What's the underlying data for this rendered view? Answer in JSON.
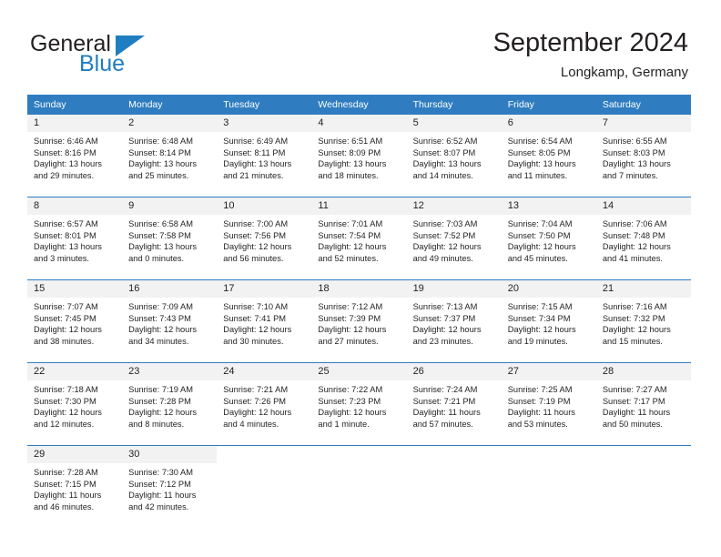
{
  "brand": {
    "name_part1": "General",
    "name_part2": "Blue",
    "flag_icon": "blue-triangle-flag-icon"
  },
  "header": {
    "title": "September 2024",
    "location": "Longkamp, Germany"
  },
  "colors": {
    "header_blue": "#2f7dc0",
    "brand_blue": "#1f7ec2",
    "daynum_bg": "#f2f2f2",
    "text": "#231f20"
  },
  "weekdays": [
    "Sunday",
    "Monday",
    "Tuesday",
    "Wednesday",
    "Thursday",
    "Friday",
    "Saturday"
  ],
  "weeks": [
    [
      {
        "day": "1",
        "sunrise": "Sunrise: 6:46 AM",
        "sunset": "Sunset: 8:16 PM",
        "daylight1": "Daylight: 13 hours",
        "daylight2": "and 29 minutes."
      },
      {
        "day": "2",
        "sunrise": "Sunrise: 6:48 AM",
        "sunset": "Sunset: 8:14 PM",
        "daylight1": "Daylight: 13 hours",
        "daylight2": "and 25 minutes."
      },
      {
        "day": "3",
        "sunrise": "Sunrise: 6:49 AM",
        "sunset": "Sunset: 8:11 PM",
        "daylight1": "Daylight: 13 hours",
        "daylight2": "and 21 minutes."
      },
      {
        "day": "4",
        "sunrise": "Sunrise: 6:51 AM",
        "sunset": "Sunset: 8:09 PM",
        "daylight1": "Daylight: 13 hours",
        "daylight2": "and 18 minutes."
      },
      {
        "day": "5",
        "sunrise": "Sunrise: 6:52 AM",
        "sunset": "Sunset: 8:07 PM",
        "daylight1": "Daylight: 13 hours",
        "daylight2": "and 14 minutes."
      },
      {
        "day": "6",
        "sunrise": "Sunrise: 6:54 AM",
        "sunset": "Sunset: 8:05 PM",
        "daylight1": "Daylight: 13 hours",
        "daylight2": "and 11 minutes."
      },
      {
        "day": "7",
        "sunrise": "Sunrise: 6:55 AM",
        "sunset": "Sunset: 8:03 PM",
        "daylight1": "Daylight: 13 hours",
        "daylight2": "and 7 minutes."
      }
    ],
    [
      {
        "day": "8",
        "sunrise": "Sunrise: 6:57 AM",
        "sunset": "Sunset: 8:01 PM",
        "daylight1": "Daylight: 13 hours",
        "daylight2": "and 3 minutes."
      },
      {
        "day": "9",
        "sunrise": "Sunrise: 6:58 AM",
        "sunset": "Sunset: 7:58 PM",
        "daylight1": "Daylight: 13 hours",
        "daylight2": "and 0 minutes."
      },
      {
        "day": "10",
        "sunrise": "Sunrise: 7:00 AM",
        "sunset": "Sunset: 7:56 PM",
        "daylight1": "Daylight: 12 hours",
        "daylight2": "and 56 minutes."
      },
      {
        "day": "11",
        "sunrise": "Sunrise: 7:01 AM",
        "sunset": "Sunset: 7:54 PM",
        "daylight1": "Daylight: 12 hours",
        "daylight2": "and 52 minutes."
      },
      {
        "day": "12",
        "sunrise": "Sunrise: 7:03 AM",
        "sunset": "Sunset: 7:52 PM",
        "daylight1": "Daylight: 12 hours",
        "daylight2": "and 49 minutes."
      },
      {
        "day": "13",
        "sunrise": "Sunrise: 7:04 AM",
        "sunset": "Sunset: 7:50 PM",
        "daylight1": "Daylight: 12 hours",
        "daylight2": "and 45 minutes."
      },
      {
        "day": "14",
        "sunrise": "Sunrise: 7:06 AM",
        "sunset": "Sunset: 7:48 PM",
        "daylight1": "Daylight: 12 hours",
        "daylight2": "and 41 minutes."
      }
    ],
    [
      {
        "day": "15",
        "sunrise": "Sunrise: 7:07 AM",
        "sunset": "Sunset: 7:45 PM",
        "daylight1": "Daylight: 12 hours",
        "daylight2": "and 38 minutes."
      },
      {
        "day": "16",
        "sunrise": "Sunrise: 7:09 AM",
        "sunset": "Sunset: 7:43 PM",
        "daylight1": "Daylight: 12 hours",
        "daylight2": "and 34 minutes."
      },
      {
        "day": "17",
        "sunrise": "Sunrise: 7:10 AM",
        "sunset": "Sunset: 7:41 PM",
        "daylight1": "Daylight: 12 hours",
        "daylight2": "and 30 minutes."
      },
      {
        "day": "18",
        "sunrise": "Sunrise: 7:12 AM",
        "sunset": "Sunset: 7:39 PM",
        "daylight1": "Daylight: 12 hours",
        "daylight2": "and 27 minutes."
      },
      {
        "day": "19",
        "sunrise": "Sunrise: 7:13 AM",
        "sunset": "Sunset: 7:37 PM",
        "daylight1": "Daylight: 12 hours",
        "daylight2": "and 23 minutes."
      },
      {
        "day": "20",
        "sunrise": "Sunrise: 7:15 AM",
        "sunset": "Sunset: 7:34 PM",
        "daylight1": "Daylight: 12 hours",
        "daylight2": "and 19 minutes."
      },
      {
        "day": "21",
        "sunrise": "Sunrise: 7:16 AM",
        "sunset": "Sunset: 7:32 PM",
        "daylight1": "Daylight: 12 hours",
        "daylight2": "and 15 minutes."
      }
    ],
    [
      {
        "day": "22",
        "sunrise": "Sunrise: 7:18 AM",
        "sunset": "Sunset: 7:30 PM",
        "daylight1": "Daylight: 12 hours",
        "daylight2": "and 12 minutes."
      },
      {
        "day": "23",
        "sunrise": "Sunrise: 7:19 AM",
        "sunset": "Sunset: 7:28 PM",
        "daylight1": "Daylight: 12 hours",
        "daylight2": "and 8 minutes."
      },
      {
        "day": "24",
        "sunrise": "Sunrise: 7:21 AM",
        "sunset": "Sunset: 7:26 PM",
        "daylight1": "Daylight: 12 hours",
        "daylight2": "and 4 minutes."
      },
      {
        "day": "25",
        "sunrise": "Sunrise: 7:22 AM",
        "sunset": "Sunset: 7:23 PM",
        "daylight1": "Daylight: 12 hours",
        "daylight2": "and 1 minute."
      },
      {
        "day": "26",
        "sunrise": "Sunrise: 7:24 AM",
        "sunset": "Sunset: 7:21 PM",
        "daylight1": "Daylight: 11 hours",
        "daylight2": "and 57 minutes."
      },
      {
        "day": "27",
        "sunrise": "Sunrise: 7:25 AM",
        "sunset": "Sunset: 7:19 PM",
        "daylight1": "Daylight: 11 hours",
        "daylight2": "and 53 minutes."
      },
      {
        "day": "28",
        "sunrise": "Sunrise: 7:27 AM",
        "sunset": "Sunset: 7:17 PM",
        "daylight1": "Daylight: 11 hours",
        "daylight2": "and 50 minutes."
      }
    ],
    [
      {
        "day": "29",
        "sunrise": "Sunrise: 7:28 AM",
        "sunset": "Sunset: 7:15 PM",
        "daylight1": "Daylight: 11 hours",
        "daylight2": "and 46 minutes."
      },
      {
        "day": "30",
        "sunrise": "Sunrise: 7:30 AM",
        "sunset": "Sunset: 7:12 PM",
        "daylight1": "Daylight: 11 hours",
        "daylight2": "and 42 minutes."
      },
      {
        "day": "",
        "sunrise": "",
        "sunset": "",
        "daylight1": "",
        "daylight2": ""
      },
      {
        "day": "",
        "sunrise": "",
        "sunset": "",
        "daylight1": "",
        "daylight2": ""
      },
      {
        "day": "",
        "sunrise": "",
        "sunset": "",
        "daylight1": "",
        "daylight2": ""
      },
      {
        "day": "",
        "sunrise": "",
        "sunset": "",
        "daylight1": "",
        "daylight2": ""
      },
      {
        "day": "",
        "sunrise": "",
        "sunset": "",
        "daylight1": "",
        "daylight2": ""
      }
    ]
  ]
}
